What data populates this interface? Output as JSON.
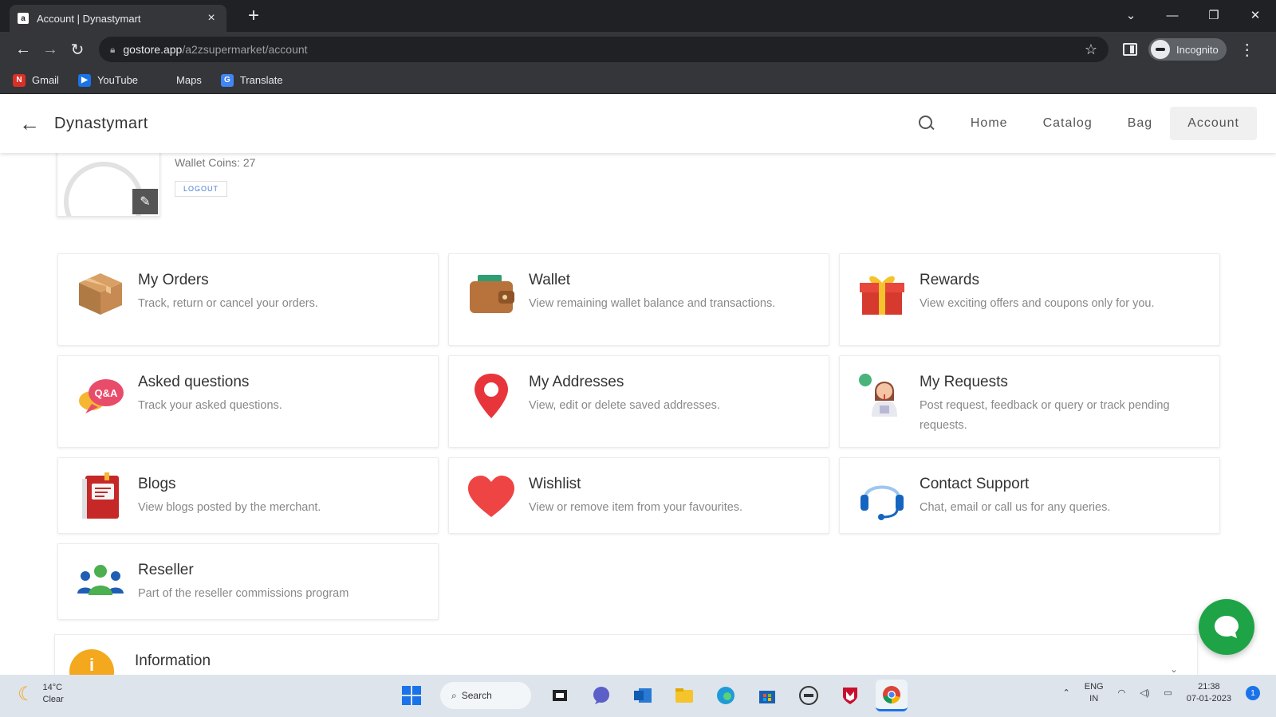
{
  "browser": {
    "tab_title": "Account | Dynastymart",
    "tab_favicon": "a",
    "new_tab": "+",
    "tab_close": "×",
    "url_host": "gostore.app",
    "url_path": "/a2zsupermarket/account",
    "profile_label": "Incognito",
    "bookmarks": [
      {
        "label": "Gmail",
        "icon": "N",
        "color": "#d93025"
      },
      {
        "label": "YouTube",
        "icon": "▶",
        "color": "#1a73e8"
      },
      {
        "label": "Maps",
        "icon": "",
        "color": "#35363a"
      },
      {
        "label": "Translate",
        "icon": "G",
        "color": "#4285f4"
      }
    ]
  },
  "header": {
    "brand": "Dynastymart",
    "nav": [
      {
        "label": "Home"
      },
      {
        "label": "Catalog"
      },
      {
        "label": "Bag"
      },
      {
        "label": "Account"
      }
    ]
  },
  "profile": {
    "wallet_coins": "Wallet Coins: 27",
    "logout": "LOGOUT"
  },
  "cards": [
    {
      "title": "My Orders",
      "desc": "Track, return or cancel your orders.",
      "icon": "box-icon"
    },
    {
      "title": "Wallet",
      "desc": "View remaining wallet balance and transactions.",
      "icon": "wallet-icon"
    },
    {
      "title": "Rewards",
      "desc": "View exciting offers and coupons only for you.",
      "icon": "gift-icon"
    },
    {
      "title": "Asked questions",
      "desc": "Track your asked questions.",
      "icon": "qa-icon"
    },
    {
      "title": "My Addresses",
      "desc": "View, edit or delete saved addresses.",
      "icon": "location-pin-icon"
    },
    {
      "title": "My Requests",
      "desc": "Post request, feedback or query or track pending requests.",
      "icon": "support-agent-icon"
    },
    {
      "title": "Blogs",
      "desc": "View blogs posted by the merchant.",
      "icon": "book-icon"
    },
    {
      "title": "Wishlist",
      "desc": "View or remove item from your favourites.",
      "icon": "heart-icon"
    },
    {
      "title": "Contact Support",
      "desc": "Chat, email or call us for any queries.",
      "icon": "headset-icon"
    },
    {
      "title": "Reseller",
      "desc": "Part of the reseller commissions program",
      "icon": "group-icon"
    }
  ],
  "info": {
    "title": "Information",
    "icon_glyph": "i"
  },
  "taskbar": {
    "weather_temp": "14°C",
    "weather_desc": "Clear",
    "search_label": "Search",
    "lang_line1": "ENG",
    "lang_line2": "IN",
    "time": "21:38",
    "date": "07-01-2023",
    "notif_count": "1"
  }
}
